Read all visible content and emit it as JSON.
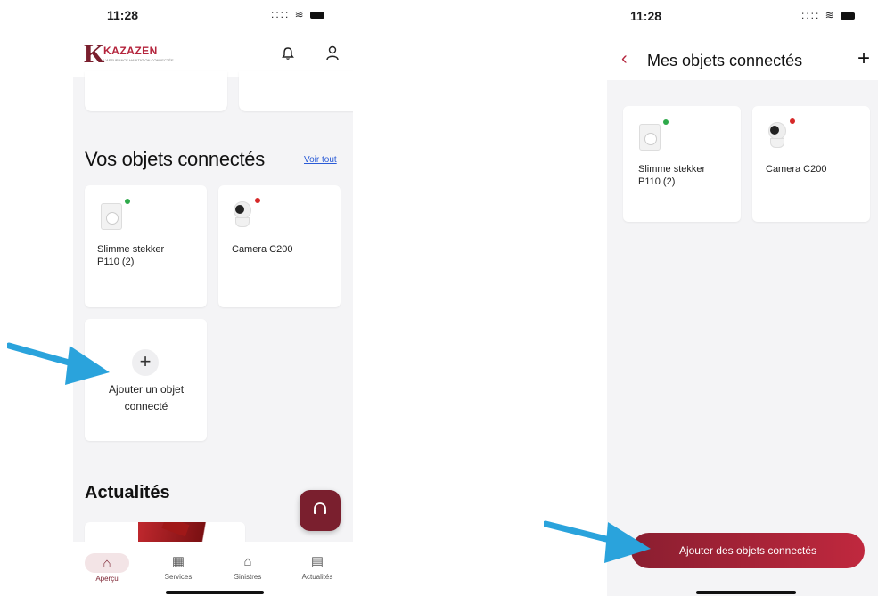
{
  "left_screen": {
    "status_time": "11:28",
    "brand": {
      "letter": "K",
      "name": "KAZAZEN",
      "tagline": "L'ASSURANCE HABITATION CONNECTÉE"
    },
    "header_icons": [
      "bell-icon",
      "user-icon"
    ],
    "section_title": "Vos objets connectés",
    "see_all_label": "Voir tout",
    "devices": [
      {
        "label": "Slimme stekker P110 (2)",
        "status_color": "#2eaa4a",
        "icon": "smart-plug"
      },
      {
        "label": "Camera C200",
        "status_color": "#d62828",
        "icon": "camera"
      }
    ],
    "add_tile": {
      "plus": "+",
      "label": "Ajouter un objet connecté"
    },
    "news_title": "Actualités",
    "support_fab_icon": "headset-icon",
    "nav": [
      {
        "label": "Aperçu",
        "icon": "home-icon",
        "active": true
      },
      {
        "label": "Services",
        "icon": "store-icon",
        "active": false
      },
      {
        "label": "Sinistres",
        "icon": "house-claim-icon",
        "active": false
      },
      {
        "label": "Actualités",
        "icon": "news-icon",
        "active": false
      }
    ]
  },
  "right_screen": {
    "status_time": "11:28",
    "back_icon": "‹",
    "title": "Mes objets connectés",
    "add_icon": "+",
    "devices": [
      {
        "label": "Slimme stekker P110 (2)",
        "status_color": "#2eaa4a",
        "icon": "smart-plug"
      },
      {
        "label": "Camera C200",
        "status_color": "#d62828",
        "icon": "camera"
      }
    ],
    "cta_label": "Ajouter des objets connectés"
  },
  "colors": {
    "brand": "#7a1f2e",
    "accent": "#b4243c",
    "link": "#2a5bd7",
    "arrow": "#2aa3dc"
  }
}
